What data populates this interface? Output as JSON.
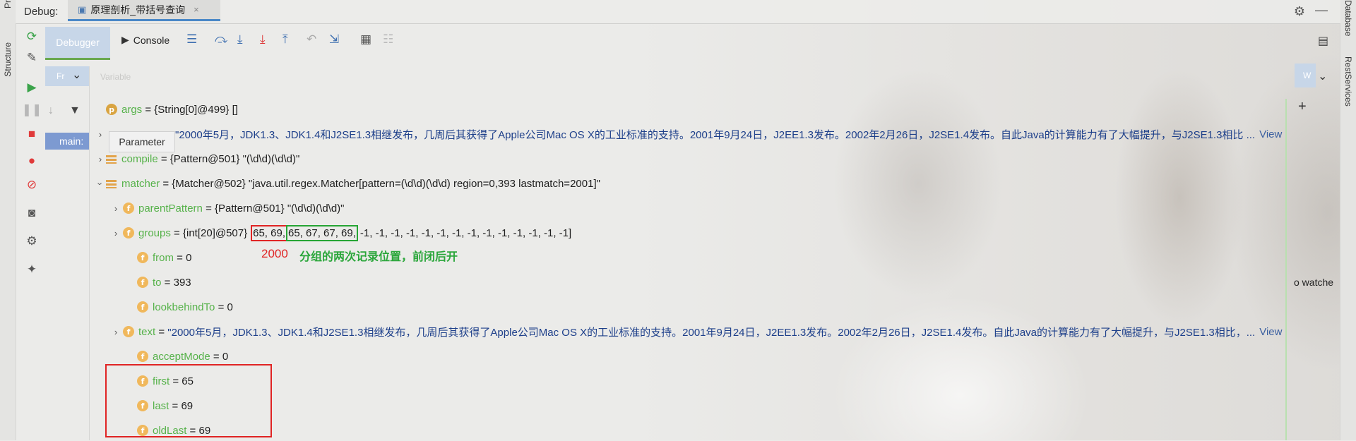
{
  "window": {
    "debug_label": "Debug:",
    "tab_title": "原理剖析_带括号查询",
    "tab_close": "×"
  },
  "left_strip": {
    "project": "Pr",
    "structure": "Structure"
  },
  "right_strip": {
    "database": "Database",
    "rest_services": "RestServices"
  },
  "toolbar": {
    "debugger_tab": "Debugger",
    "console_tab": "Console"
  },
  "frames": {
    "header": "Fr",
    "main_row": "main:",
    "tooltip": "Parameter"
  },
  "variables_header": "Variable",
  "watches": {
    "header": "W",
    "text": "o watche"
  },
  "variables": [
    {
      "name": "args",
      "value": "{String[0]@499} []",
      "badge": "p"
    },
    {
      "name": "",
      "value": "\"2000年5月，JDK1.3、JDK1.4和J2SE1.3相继发布，几周后其获得了Apple公司Mac OS X的工业标准的支持。2001年9月24日，J2EE1.3发布。2002年2月26日，J2SE1.4发布。自此Java的计算能力有了大幅提升，与J2SE1.3相比 ...",
      "view": "View"
    },
    {
      "name": "compile",
      "value": "{Pattern@501} \"(\\d\\d)(\\d\\d)\""
    },
    {
      "name": "matcher",
      "value": "{Matcher@502} \"java.util.regex.Matcher[pattern=(\\d\\d)(\\d\\d) region=0,393 lastmatch=2001]\""
    },
    {
      "name": "parentPattern",
      "value": "{Pattern@501} \"(\\d\\d)(\\d\\d)\"",
      "badge": "f"
    },
    {
      "name": "groups",
      "prefix": "{int[20]@507}",
      "red_box": "65, 69,",
      "green_box": "65, 67, 67, 69,",
      "rest": "-1, -1, -1, -1, -1, -1, -1, -1, -1, -1, -1, -1, -1, -1]",
      "badge": "f"
    },
    {
      "name": "from",
      "value": "0",
      "badge": "f"
    },
    {
      "name": "to",
      "value": "393",
      "badge": "f"
    },
    {
      "name": "lookbehindTo",
      "value": "0",
      "badge": "f"
    },
    {
      "name": "text",
      "value": "\"2000年5月，JDK1.3、JDK1.4和J2SE1.3相继发布，几周后其获得了Apple公司Mac OS X的工业标准的支持。2001年9月24日，J2EE1.3发布。2002年2月26日，J2SE1.4发布。自此Java的计算能力有了大幅提升，与J2SE1.3相比，...",
      "view": "View",
      "badge": "f"
    },
    {
      "name": "acceptMode",
      "value": "0",
      "badge": "f"
    },
    {
      "name": "first",
      "value": "65",
      "badge": "f"
    },
    {
      "name": "last",
      "value": "69",
      "badge": "f"
    },
    {
      "name": "oldLast",
      "value": "69",
      "badge": "f"
    }
  ],
  "annotations": {
    "red_label": "2000",
    "green_label": "分组的两次记录位置，前闭后开"
  },
  "colors": {
    "accent_blue": "#4a88c7",
    "selected_blue": "#7d9ad1",
    "var_name_green": "#56b24a",
    "annotation_red": "#e02424",
    "annotation_green": "#26a534"
  }
}
